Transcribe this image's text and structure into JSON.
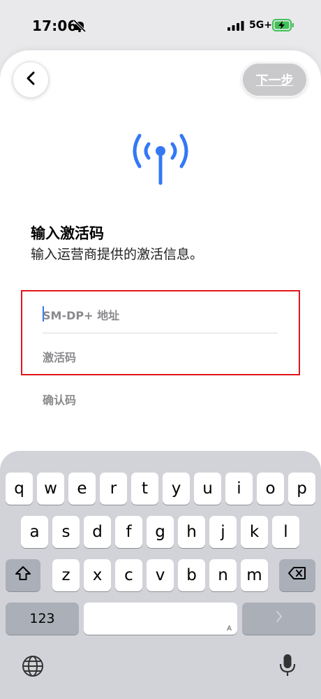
{
  "status_bar": {
    "time": "17:06",
    "network": "5G+"
  },
  "header": {
    "next_label": "下一步"
  },
  "content": {
    "title": "输入激活码",
    "subtitle": "输入运营商提供的激活信息。",
    "fields": {
      "smdp_placeholder": "SM-DP+ 地址",
      "activation_placeholder": "激活码",
      "confirm_placeholder": "确认码"
    }
  },
  "keyboard": {
    "row1": [
      "q",
      "w",
      "e",
      "r",
      "t",
      "y",
      "u",
      "i",
      "o",
      "p"
    ],
    "row2": [
      "a",
      "s",
      "d",
      "f",
      "g",
      "h",
      "j",
      "k",
      "l"
    ],
    "row3": [
      "z",
      "x",
      "c",
      "v",
      "b",
      "n",
      "m"
    ],
    "numbers_label": "123",
    "space_hint": "A"
  },
  "colors": {
    "accent": "#3478f6",
    "highlight": "#e0151c",
    "button_disabled": "#c9c9cb"
  }
}
